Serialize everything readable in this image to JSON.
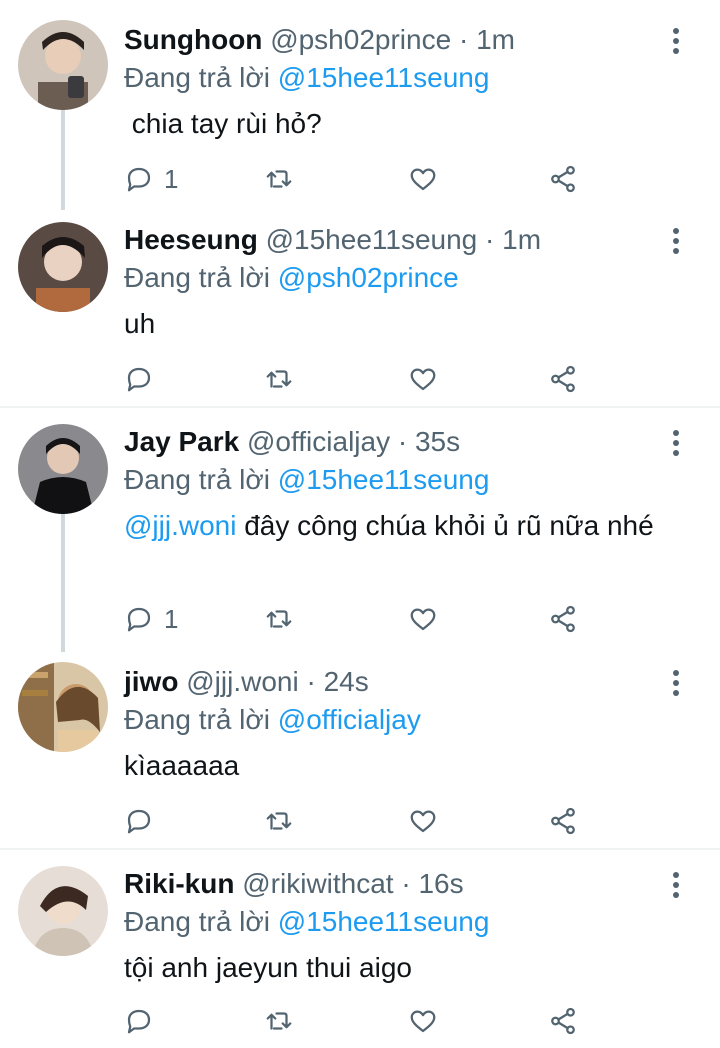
{
  "replying_label": "Đang trả lời",
  "dot": "·",
  "tweets": [
    {
      "name": "Sunghoon",
      "handle": "@psh02prince",
      "time": "1m",
      "reply_to": "@15hee11seung",
      "text": " chia tay rùi hỏ?",
      "reply_count": "1",
      "avatar_color": "#bfb2a6"
    },
    {
      "name": "Heeseung",
      "handle": "@15hee11seung",
      "time": "1m",
      "reply_to": "@psh02prince",
      "text": "uh",
      "reply_count": "",
      "avatar_color": "#3a2f2c"
    },
    {
      "name": "Jay Park",
      "handle": "@officialjay",
      "time": "35s",
      "reply_to": "@15hee11seung",
      "text_mention": "@jjj.woni",
      "text": " đây công chúa khỏi ủ rũ nữa nhé",
      "reply_count": "1",
      "avatar_color": "#2b2b2e"
    },
    {
      "name": "jiwo",
      "handle": "@jjj.woni",
      "time": "24s",
      "reply_to": "@officialjay",
      "text": "kìaaaaaa",
      "reply_count": "",
      "avatar_color": "#b8916a"
    },
    {
      "name": "Riki-kun",
      "handle": "@rikiwithcat",
      "time": "16s",
      "reply_to": "@15hee11seung",
      "text": "tội anh jaeyun thui aigo",
      "reply_count": "",
      "avatar_color": "#d8cfc6"
    }
  ],
  "colors": {
    "accent": "#1d9bf0",
    "muted": "#536471",
    "line": "#cfd9de"
  },
  "icons": [
    "reply-icon",
    "retweet-icon",
    "like-icon",
    "share-icon",
    "more-icon"
  ]
}
